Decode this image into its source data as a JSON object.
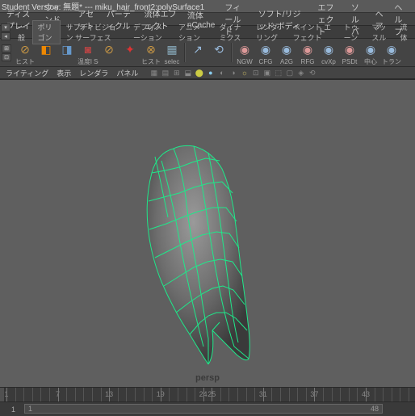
{
  "title": "Student Version: 無題* --- miku_hair_front2:polySurface1",
  "menu": [
    "ディスプレイ",
    "ウィンドウ",
    "アセット",
    "パーティクル",
    "流体エフェクト",
    "流体 nCache",
    "フィールド",
    "ソフト/リジッド ボディ",
    "エフェクト",
    "ソルバ",
    "ヘア",
    "ヘルプ"
  ],
  "tabs": [
    {
      "label": "一般",
      "active": false
    },
    {
      "label": "ポリゴン",
      "active": true
    },
    {
      "label": "サブディビジョン サーフェス",
      "active": false
    },
    {
      "label": "デフォメーション",
      "active": false
    },
    {
      "label": "アニメーション",
      "active": false
    },
    {
      "label": "ダイナミクス",
      "active": false
    },
    {
      "label": "レンダリング",
      "active": false
    },
    {
      "label": "ペイント エフェクト",
      "active": false
    },
    {
      "label": "トゥーン",
      "active": false
    },
    {
      "label": "マッスル",
      "active": false
    },
    {
      "label": "流体",
      "active": false
    }
  ],
  "shelf": [
    {
      "label": "ヒスト",
      "col": "#c94",
      "glyph": "⊘"
    },
    {
      "label": "",
      "col": "#e80",
      "glyph": "◧"
    },
    {
      "label": "",
      "col": "#69c",
      "glyph": "◨"
    },
    {
      "label": "温度l Set",
      "col": "#b44",
      "glyph": "◙"
    },
    {
      "label": "",
      "col": "#c94",
      "glyph": "⊘"
    },
    {
      "label": "",
      "col": "#d33",
      "glyph": "✦"
    },
    {
      "label": "ヒスト",
      "col": "#c94",
      "glyph": "⊗"
    },
    {
      "label": "selec",
      "col": "#8ab",
      "glyph": "▦"
    },
    {
      "sep": true
    },
    {
      "label": "",
      "col": "#9bd",
      "glyph": "↗"
    },
    {
      "label": "",
      "col": "#9bd",
      "glyph": "⟲"
    },
    {
      "sep": true
    },
    {
      "label": "NGW",
      "col": "#d99",
      "glyph": "◉"
    },
    {
      "label": "CFG",
      "col": "#9bd",
      "glyph": "◉"
    },
    {
      "label": "A2G",
      "col": "#9bd",
      "glyph": "◉"
    },
    {
      "label": "RFG",
      "col": "#d99",
      "glyph": "◉"
    },
    {
      "label": "cvXp",
      "col": "#9bd",
      "glyph": "◉"
    },
    {
      "label": "PSDt",
      "col": "#d99",
      "glyph": "◉"
    },
    {
      "label": "中心",
      "col": "#9bd",
      "glyph": "◉"
    },
    {
      "label": "トラン",
      "col": "#9bd",
      "glyph": "◉"
    }
  ],
  "panel": [
    "ライティング",
    "表示",
    "レンダラ",
    "パネル"
  ],
  "panel_icons": [
    "▦",
    "▤",
    "⊞",
    "⬓",
    "⬤",
    "●",
    "◐",
    "◑",
    "☼",
    "⊡",
    "▣",
    "⬚",
    "▢",
    "◈",
    "⟲"
  ],
  "icon_colors": [
    "#888",
    "#888",
    "#888",
    "#888",
    "#cc4",
    "#8ce",
    "#888",
    "#888",
    "#cb6",
    "#888",
    "#888",
    "#888",
    "#888",
    "#888",
    "#888"
  ],
  "view_label": "persp",
  "timeline": {
    "start": 1,
    "end": 48,
    "current": 24,
    "range_start": 1,
    "range_end": 48,
    "ctrl_left": "1"
  }
}
